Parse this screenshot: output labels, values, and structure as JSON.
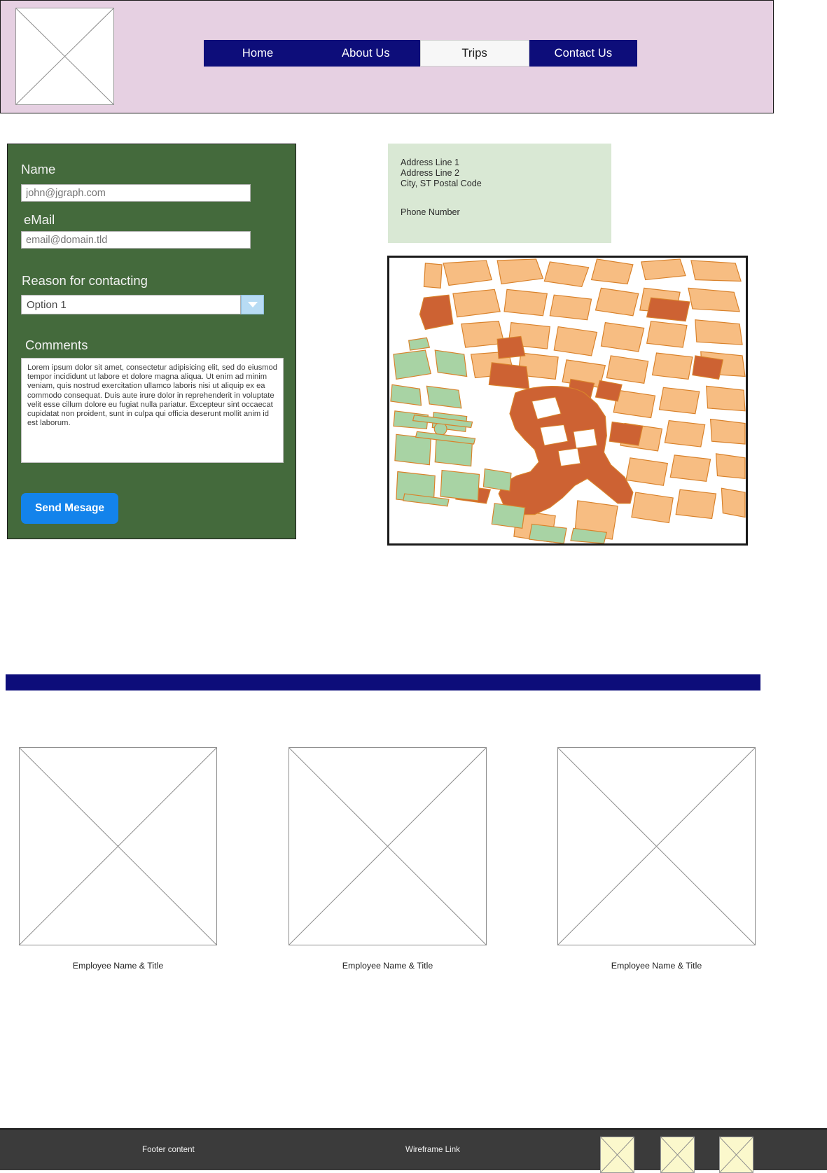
{
  "colors": {
    "header_band": "#e6d0e2",
    "nav_bg": "#0d0d7a",
    "nav_active_bg": "#f7f7f7",
    "form_panel": "#446a3c",
    "address_bg": "#d9e8d4",
    "send_button": "#1383eb",
    "divider": "#0d0d7a",
    "footer_bg": "#3b3b3b",
    "footer_thumb": "#fbf8cc",
    "map_building_light": "#f7bd82",
    "map_building_dark": "#cd6233",
    "map_park": "#a8d3a4",
    "map_road": "#ffffff"
  },
  "header": {
    "logo_alt": "image-placeholder",
    "nav": [
      {
        "label": "Home",
        "active": false
      },
      {
        "label": "About Us",
        "active": false
      },
      {
        "label": "Trips",
        "active": true
      },
      {
        "label": "Contact Us",
        "active": false
      }
    ]
  },
  "form": {
    "name": {
      "label": "Name",
      "value": "",
      "placeholder": "john@jgraph.com"
    },
    "email": {
      "label": "eMail",
      "value": "",
      "placeholder": "email@domain.tld"
    },
    "reason": {
      "label": "Reason for contacting",
      "selected": "Option 1"
    },
    "comments": {
      "label": "Comments",
      "value": "Lorem ipsum dolor sit amet, consectetur adipisicing elit, sed do eiusmod tempor incididunt ut labore et dolore magna aliqua. Ut enim ad minim veniam, quis nostrud exercitation ullamco laboris nisi ut aliquip ex ea commodo consequat. Duis aute irure dolor in reprehenderit in voluptate velit esse cillum dolore eu fugiat nulla pariatur. Excepteur sint occaecat cupidatat non proident, sunt in culpa qui officia deserunt mollit anim id est laborum."
    },
    "submit_label": "Send Mesage"
  },
  "address": {
    "line1": "Address Line 1",
    "line2": "Address Line 2",
    "line3": "City, ST  Postal Code",
    "phone": "Phone Number"
  },
  "map": {
    "alt": "street-map-illustration"
  },
  "employees": [
    {
      "caption": "Employee Name & Title"
    },
    {
      "caption": "Employee Name & Title"
    },
    {
      "caption": "Employee Name & Title"
    }
  ],
  "footer": {
    "content_label": "Footer content",
    "link_label": "Wireframe Link",
    "thumbs": [
      {
        "alt": "image-placeholder"
      },
      {
        "alt": "image-placeholder"
      },
      {
        "alt": "image-placeholder"
      }
    ]
  }
}
